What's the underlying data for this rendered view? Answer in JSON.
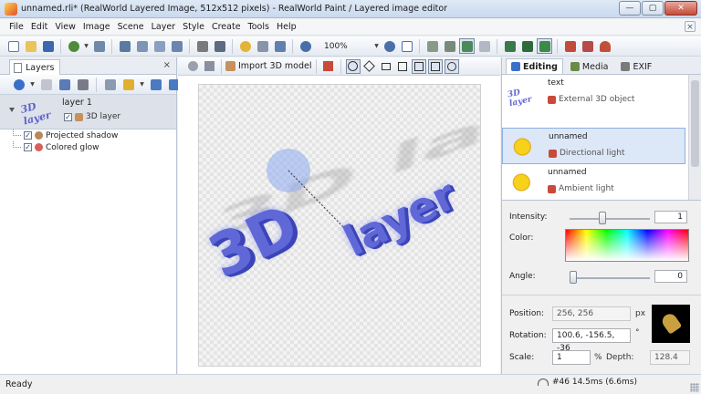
{
  "window": {
    "title": "unnamed.rli* (RealWorld Layered Image, 512x512 pixels) - RealWorld Paint / Layered image editor",
    "minimize": "—",
    "maximize": "▢",
    "close": "✕"
  },
  "menu": {
    "items": [
      "File",
      "Edit",
      "View",
      "Image",
      "Scene",
      "Layer",
      "Style",
      "Create",
      "Tools",
      "Help"
    ],
    "close_glyph": "×"
  },
  "toolbar": {
    "zoom_value": "100%"
  },
  "layers_panel": {
    "tab_label": "Layers",
    "close_glyph": "×",
    "layer": {
      "name": "layer 1",
      "thumb_text": "3D layer",
      "sub_label": "3D layer",
      "sub_checked": "✓"
    },
    "effects": [
      {
        "label": "Projected shadow",
        "checked": "✓",
        "color": "#b8875a"
      },
      {
        "label": "Colored glow",
        "checked": "✓",
        "color": "#d8605a"
      }
    ]
  },
  "canvas_toolbar": {
    "import_label": "Import 3D model"
  },
  "canvas": {
    "text_3d": "3D",
    "text_layer": "layer",
    "text_shadow": "3D layer"
  },
  "right_panel": {
    "tabs": [
      {
        "label": "Editing",
        "color": "#3a6fc9"
      },
      {
        "label": "Media",
        "color": "#6a8a4a"
      },
      {
        "label": "EXIF",
        "color": "#7a7a7a"
      }
    ],
    "objects": [
      {
        "name": "text",
        "type": "External 3D object",
        "thumb_text": "3D layer"
      },
      {
        "name": "unnamed",
        "type": "Directional light"
      },
      {
        "name": "unnamed",
        "type": "Ambient light"
      }
    ],
    "properties": {
      "intensity_label": "Intensity:",
      "intensity_value": "1",
      "intensity": 0.4,
      "color_label": "Color:",
      "angle_label": "Angle:",
      "angle_value": "0",
      "angle": 0.0
    },
    "transform": {
      "position_label": "Position:",
      "position_value": "256, 256",
      "position_unit": "px",
      "rotation_label": "Rotation:",
      "rotation_value": "100.6, -156.5, -36",
      "rotation_unit": "°",
      "scale_label": "Scale:",
      "scale_value": "1",
      "scale_unit": "%",
      "depth_label": "Depth:",
      "depth_value": "128.4"
    }
  },
  "status": {
    "text": "Ready",
    "stats": "#46 14.5ms (6.6ms)"
  },
  "colors": {
    "accent_blue": "#5f68d6",
    "selection": "#dce8f8",
    "light_circle": "#8caaf0"
  }
}
